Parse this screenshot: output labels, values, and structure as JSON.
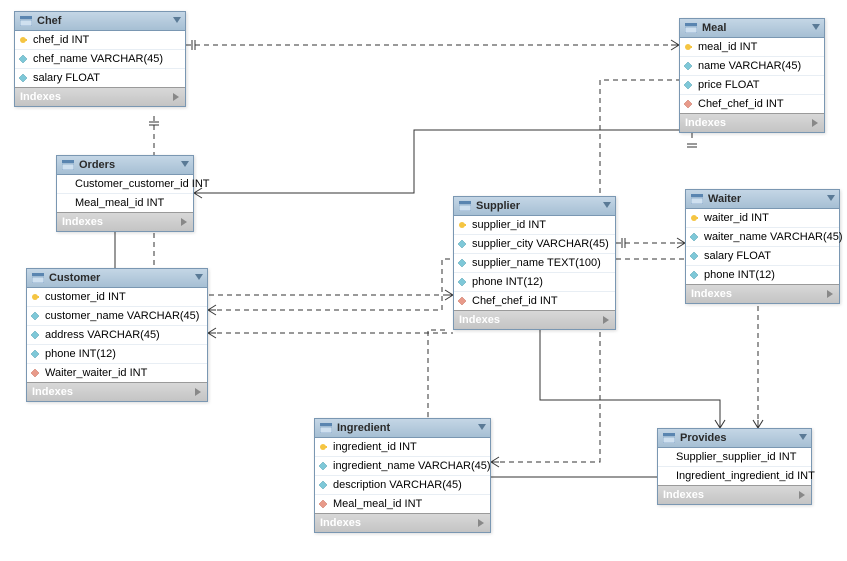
{
  "tables": {
    "chef": {
      "title": "Chef",
      "cols": [
        {
          "icon": "pk",
          "text": "chef_id INT"
        },
        {
          "icon": "attr",
          "text": "chef_name VARCHAR(45)"
        },
        {
          "icon": "attr",
          "text": "salary FLOAT"
        }
      ],
      "indexes": "Indexes"
    },
    "orders": {
      "title": "Orders",
      "cols": [
        {
          "icon": "none",
          "text": "Customer_customer_id INT"
        },
        {
          "icon": "none",
          "text": "Meal_meal_id INT"
        }
      ],
      "indexes": "Indexes"
    },
    "customer": {
      "title": "Customer",
      "cols": [
        {
          "icon": "pk",
          "text": "customer_id INT"
        },
        {
          "icon": "attr",
          "text": "customer_name VARCHAR(45)"
        },
        {
          "icon": "attr",
          "text": "address VARCHAR(45)"
        },
        {
          "icon": "attr",
          "text": "phone INT(12)"
        },
        {
          "icon": "fk",
          "text": "Waiter_waiter_id INT"
        }
      ],
      "indexes": "Indexes"
    },
    "meal": {
      "title": "Meal",
      "cols": [
        {
          "icon": "pk",
          "text": "meal_id INT"
        },
        {
          "icon": "attr",
          "text": "name VARCHAR(45)"
        },
        {
          "icon": "attr",
          "text": "price FLOAT"
        },
        {
          "icon": "fk",
          "text": "Chef_chef_id INT"
        }
      ],
      "indexes": "Indexes"
    },
    "supplier": {
      "title": "Supplier",
      "cols": [
        {
          "icon": "pk",
          "text": "supplier_id INT"
        },
        {
          "icon": "attr",
          "text": "supplier_city VARCHAR(45)"
        },
        {
          "icon": "attr",
          "text": "supplier_name TEXT(100)"
        },
        {
          "icon": "attr",
          "text": "phone INT(12)"
        },
        {
          "icon": "fk",
          "text": "Chef_chef_id INT"
        }
      ],
      "indexes": "Indexes"
    },
    "waiter": {
      "title": "Waiter",
      "cols": [
        {
          "icon": "pk",
          "text": "waiter_id INT"
        },
        {
          "icon": "attr",
          "text": "waiter_name VARCHAR(45)"
        },
        {
          "icon": "attr",
          "text": "salary FLOAT"
        },
        {
          "icon": "attr",
          "text": "phone INT(12)"
        }
      ],
      "indexes": "Indexes"
    },
    "ingredient": {
      "title": "Ingredient",
      "cols": [
        {
          "icon": "pk",
          "text": "ingredient_id INT"
        },
        {
          "icon": "attr",
          "text": "ingredient_name VARCHAR(45)"
        },
        {
          "icon": "attr",
          "text": "description VARCHAR(45)"
        },
        {
          "icon": "fk",
          "text": "Meal_meal_id INT"
        }
      ],
      "indexes": "Indexes"
    },
    "provides": {
      "title": "Provides",
      "cols": [
        {
          "icon": "none",
          "text": "Supplier_supplier_id INT"
        },
        {
          "icon": "none",
          "text": "Ingredient_ingredient_id INT"
        }
      ],
      "indexes": "Indexes"
    }
  },
  "relationships": [
    {
      "from": "chef",
      "to": "meal",
      "style": "dashed"
    },
    {
      "from": "chef",
      "to": "supplier",
      "style": "dashed"
    },
    {
      "from": "orders",
      "to": "customer",
      "style": "solid"
    },
    {
      "from": "orders",
      "to": "meal",
      "style": "solid"
    },
    {
      "from": "customer",
      "to": "supplier",
      "style": "dashed"
    },
    {
      "from": "customer",
      "to": "waiter",
      "style": "dashed"
    },
    {
      "from": "supplier",
      "to": "waiter",
      "style": "dashed"
    },
    {
      "from": "supplier",
      "to": "ingredient",
      "style": "dashed"
    },
    {
      "from": "ingredient",
      "to": "meal",
      "style": "dashed"
    },
    {
      "from": "provides",
      "to": "supplier",
      "style": "solid"
    },
    {
      "from": "provides",
      "to": "ingredient",
      "style": "solid"
    },
    {
      "from": "provides",
      "to": "waiter",
      "style": "dashed"
    }
  ]
}
